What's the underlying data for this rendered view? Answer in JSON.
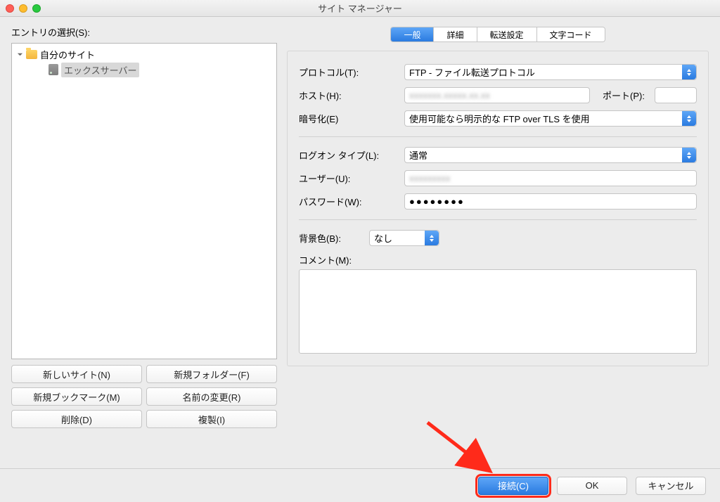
{
  "window": {
    "title": "サイト マネージャー"
  },
  "sidebar": {
    "label": "エントリの選択(S):",
    "root_name": "自分のサイト",
    "selected_site": "エックスサーバー"
  },
  "sidebar_buttons": {
    "new_site": "新しいサイト(N)",
    "new_folder": "新規フォルダー(F)",
    "new_bookmark": "新規ブックマーク(M)",
    "rename": "名前の変更(R)",
    "delete": "削除(D)",
    "duplicate": "複製(I)"
  },
  "tabs": {
    "general": "一般",
    "advanced": "詳細",
    "transfer": "転送設定",
    "charset": "文字コード"
  },
  "form": {
    "protocol_label": "プロトコル(T):",
    "protocol_value": "FTP - ファイル転送プロトコル",
    "host_label": "ホスト(H):",
    "host_value": "",
    "port_label": "ポート(P):",
    "port_value": "",
    "encryption_label": "暗号化(E)",
    "encryption_value": "使用可能なら明示的な FTP over TLS を使用",
    "logon_type_label": "ログオン タイプ(L):",
    "logon_type_value": "通常",
    "user_label": "ユーザー(U):",
    "user_value": "",
    "password_label": "パスワード(W):",
    "password_value": "●●●●●●●●",
    "bgcolor_label": "背景色(B):",
    "bgcolor_value": "なし",
    "comment_label": "コメント(M):"
  },
  "footer": {
    "connect": "接続(C)",
    "ok": "OK",
    "cancel": "キャンセル"
  }
}
